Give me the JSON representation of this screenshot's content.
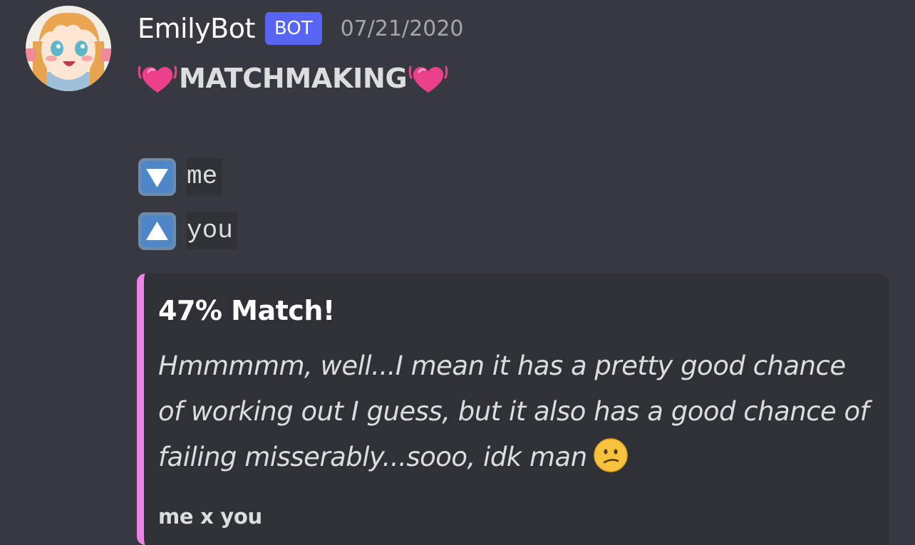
{
  "message": {
    "author": {
      "name": "EmilyBot",
      "tag": "BOT"
    },
    "timestamp": "07/21/2020",
    "title": "MATCHMAKING",
    "lines": [
      {
        "icon": "down-arrow-icon",
        "text": "me"
      },
      {
        "icon": "up-arrow-icon",
        "text": "you"
      }
    ],
    "embed": {
      "accent_color": "#ef83e6",
      "title": "47% Match!",
      "description": "Hmmmmm, well...I mean it has a pretty good chance of working out I guess, but it also has a good chance of failing misserably...sooo, idk man",
      "footer": "me x you"
    }
  },
  "colors": {
    "background": "#36393f",
    "embed_background": "#2f3136",
    "bot_tag": "#5865f2"
  }
}
